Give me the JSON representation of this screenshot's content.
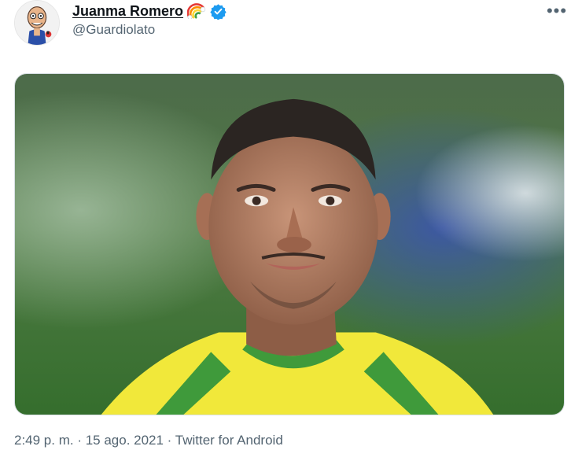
{
  "user": {
    "display_name": "Juanma Romero",
    "handle": "@Guardiolato",
    "emoji_icon": "rainbow-icon",
    "verified_icon": "verified-badge-icon"
  },
  "actions": {
    "more_label": "•••"
  },
  "meta": {
    "text": "2:49 p. m. · 15 ago. 2021 · Twitter for Android"
  },
  "colors": {
    "verified": "#1d9bf0",
    "secondary_text": "#536471",
    "jersey_yellow": "#f1e83a",
    "jersey_green": "#3f9a3b"
  }
}
